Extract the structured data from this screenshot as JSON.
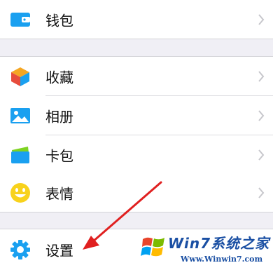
{
  "menu": {
    "wallet": {
      "label": "钱包",
      "icon": "wallet-icon"
    },
    "favorites": {
      "label": "收藏",
      "icon": "favorites-cube-icon"
    },
    "album": {
      "label": "相册",
      "icon": "album-picture-icon"
    },
    "card_package": {
      "label": "卡包",
      "icon": "card-package-icon"
    },
    "stickers": {
      "label": "表情",
      "icon": "smiley-icon"
    },
    "settings": {
      "label": "设置",
      "icon": "gear-icon"
    }
  },
  "watermark": {
    "title": "Win7系统之家",
    "url": "Www.Winwin7.com"
  },
  "colors": {
    "accent_blue": "#1aa0f0",
    "arrow_red": "#e02020",
    "background": "#f0eff5"
  }
}
